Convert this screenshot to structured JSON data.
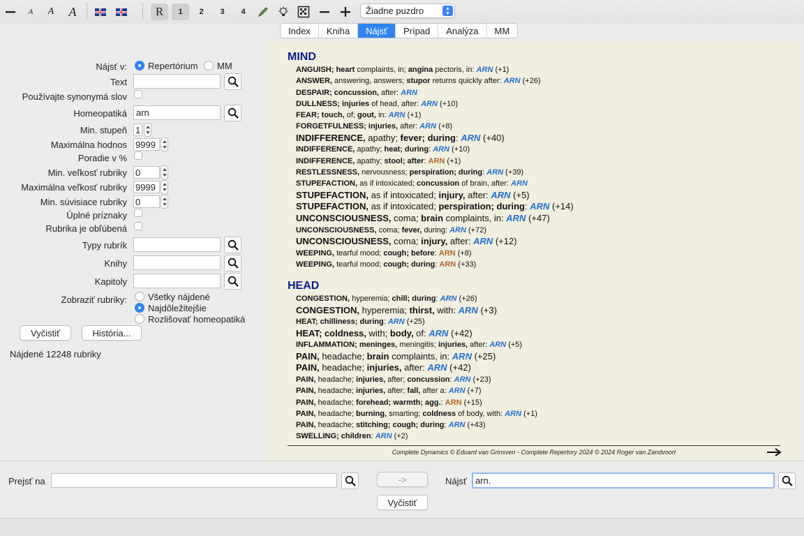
{
  "toolbar": {
    "font_small": "A",
    "font_medium": "A",
    "font_large": "A",
    "mode_r": "R",
    "grade_1": "1",
    "grade_2": "2",
    "grade_3": "3",
    "grade_4": "4",
    "box_select": "Žiadne puzdro"
  },
  "tabs": [
    "Index",
    "Kniha",
    "Nájsť",
    "Prípad",
    "Analýza",
    "MM"
  ],
  "search_form": {
    "find_in_label": "Nájsť v:",
    "opt_repertory": "Repertórium",
    "opt_mm": "MM",
    "text_label": "Text",
    "text_value": "",
    "synonyms_label": "Používajte synonymá slov",
    "remedy_label": "Homeopatiká",
    "remedy_value": "arn",
    "min_degree_label": "Min. stupeň",
    "min_degree_value": "1",
    "max_value_label": "Maximálna hodnos",
    "max_value_value": "9999",
    "order_pct_label": "Poradie v %",
    "min_rubric_size_label": "Min. veľkosť rubriky",
    "min_rubric_size_value": "0",
    "max_rubric_size_label": "Maximálna veľkosť rubriky",
    "max_rubric_size_value": "9999",
    "min_related_label": "Min. súvisiace rubriky",
    "min_related_value": "0",
    "full_symptoms_label": "Úplné príznaky",
    "favourite_label": "Rubrika je obľúbená",
    "rubric_types_label": "Typy rubrík",
    "books_label": "Knihy",
    "chapters_label": "Kapitoly",
    "show_rubrics_label": "Zobraziť rubriky:",
    "show_all": "Všetky nájdené",
    "show_important": "Najdôležitejšie",
    "show_distinguish": "Rozlišovať homeopatiká",
    "clear_button": "Vyčistiť",
    "history_button": "História...",
    "found_text": "Nájdené 12248 rubriky"
  },
  "results": [
    {
      "chapter": "MIND",
      "rubrics": [
        {
          "big": false,
          "parts": [
            [
              "b",
              "ANGUISH; heart"
            ],
            [
              "n",
              " complaints, in; "
            ],
            [
              "b",
              "angina"
            ],
            [
              "n",
              " pectoris, in: "
            ]
          ],
          "remedy": "ARN",
          "brown": false,
          "extra": " (+1)"
        },
        {
          "big": false,
          "parts": [
            [
              "b",
              "ANSWER,"
            ],
            [
              "n",
              " answering, answers; "
            ],
            [
              "b",
              "stupor"
            ],
            [
              "n",
              " returns quickly after: "
            ]
          ],
          "remedy": "ARN",
          "brown": false,
          "extra": " (+26)"
        },
        {
          "big": false,
          "parts": [
            [
              "b",
              "DESPAIR; concussion,"
            ],
            [
              "n",
              " after: "
            ]
          ],
          "remedy": "ARN",
          "brown": false,
          "extra": ""
        },
        {
          "big": false,
          "parts": [
            [
              "b",
              "DULLNESS; injuries"
            ],
            [
              "n",
              " of head, after: "
            ]
          ],
          "remedy": "ARN",
          "brown": false,
          "extra": " (+10)"
        },
        {
          "big": false,
          "parts": [
            [
              "b",
              "FEAR; touch,"
            ],
            [
              "n",
              " of; "
            ],
            [
              "b",
              "gout,"
            ],
            [
              "n",
              " in: "
            ]
          ],
          "remedy": "ARN",
          "brown": false,
          "extra": " (+1)"
        },
        {
          "big": false,
          "parts": [
            [
              "b",
              "FORGETFULNESS; injuries,"
            ],
            [
              "n",
              " after: "
            ]
          ],
          "remedy": "ARN",
          "brown": false,
          "extra": " (+8)"
        },
        {
          "big": true,
          "parts": [
            [
              "b",
              "INDIFFERENCE,"
            ],
            [
              "n",
              " apathy; "
            ],
            [
              "b",
              "fever; during"
            ],
            [
              "n",
              ": "
            ]
          ],
          "remedy": "ARN",
          "brown": false,
          "extra": " (+40)"
        },
        {
          "big": false,
          "parts": [
            [
              "b",
              "INDIFFERENCE,"
            ],
            [
              "n",
              " apathy; "
            ],
            [
              "b",
              "heat; during"
            ],
            [
              "n",
              ": "
            ]
          ],
          "remedy": "ARN",
          "brown": false,
          "extra": " (+10)"
        },
        {
          "big": false,
          "parts": [
            [
              "b",
              "INDIFFERENCE,"
            ],
            [
              "n",
              " apathy; "
            ],
            [
              "b",
              "stool; after"
            ],
            [
              "n",
              ": "
            ]
          ],
          "remedy": "ARN",
          "brown": true,
          "extra": " (+1)"
        },
        {
          "big": false,
          "parts": [
            [
              "b",
              "RESTLESSNESS,"
            ],
            [
              "n",
              " nervousness; "
            ],
            [
              "b",
              "perspiration; during"
            ],
            [
              "n",
              ": "
            ]
          ],
          "remedy": "ARN",
          "brown": false,
          "extra": " (+39)"
        },
        {
          "big": false,
          "parts": [
            [
              "b",
              "STUPEFACTION,"
            ],
            [
              "n",
              " as if intoxicated; "
            ],
            [
              "b",
              "concussion"
            ],
            [
              "n",
              " of brain, after: "
            ]
          ],
          "remedy": "ARN",
          "brown": false,
          "extra": ""
        },
        {
          "big": true,
          "parts": [
            [
              "b",
              "STUPEFACTION,"
            ],
            [
              "n",
              " as if intoxicated; "
            ],
            [
              "b",
              "injury,"
            ],
            [
              "n",
              " after: "
            ]
          ],
          "remedy": "ARN",
          "brown": false,
          "extra": " (+5)"
        },
        {
          "big": true,
          "parts": [
            [
              "b",
              "STUPEFACTION,"
            ],
            [
              "n",
              " as if intoxicated; "
            ],
            [
              "b",
              "perspiration; during"
            ],
            [
              "n",
              ": "
            ]
          ],
          "remedy": "ARN",
          "brown": false,
          "extra": " (+14)"
        },
        {
          "big": true,
          "parts": [
            [
              "b",
              "UNCONSCIOUSNESS,"
            ],
            [
              "n",
              " coma; "
            ],
            [
              "b",
              "brain"
            ],
            [
              "n",
              " complaints, in: "
            ]
          ],
          "remedy": "ARN",
          "brown": false,
          "extra": " (+47)"
        },
        {
          "big": false,
          "parts": [
            [
              "b",
              "UNCONSCIOUSNESS,"
            ],
            [
              "n",
              " coma; "
            ],
            [
              "b",
              "fever,"
            ],
            [
              "n",
              " during: "
            ]
          ],
          "remedy": "ARN",
          "brown": false,
          "extra": " (+72)"
        },
        {
          "big": true,
          "parts": [
            [
              "b",
              "UNCONSCIOUSNESS,"
            ],
            [
              "n",
              " coma; "
            ],
            [
              "b",
              "injury,"
            ],
            [
              "n",
              " after: "
            ]
          ],
          "remedy": "ARN",
          "brown": false,
          "extra": " (+12)"
        },
        {
          "big": false,
          "parts": [
            [
              "b",
              "WEEPING,"
            ],
            [
              "n",
              " tearful mood; "
            ],
            [
              "b",
              "cough; before"
            ],
            [
              "n",
              ": "
            ]
          ],
          "remedy": "ARN",
          "brown": true,
          "extra": " (+8)"
        },
        {
          "big": false,
          "parts": [
            [
              "b",
              "WEEPING,"
            ],
            [
              "n",
              " tearful mood; "
            ],
            [
              "b",
              "cough; during"
            ],
            [
              "n",
              ": "
            ]
          ],
          "remedy": "ARN",
          "brown": true,
          "extra": " (+33)"
        }
      ]
    },
    {
      "chapter": "HEAD",
      "rubrics": [
        {
          "big": false,
          "parts": [
            [
              "b",
              "CONGESTION,"
            ],
            [
              "n",
              " hyperemia; "
            ],
            [
              "b",
              "chill; during"
            ],
            [
              "n",
              ": "
            ]
          ],
          "remedy": "ARN",
          "brown": false,
          "extra": " (+26)"
        },
        {
          "big": true,
          "parts": [
            [
              "b",
              "CONGESTION,"
            ],
            [
              "n",
              " hyperemia; "
            ],
            [
              "b",
              "thirst,"
            ],
            [
              "n",
              " with: "
            ]
          ],
          "remedy": "ARN",
          "brown": false,
          "extra": " (+3)"
        },
        {
          "big": false,
          "parts": [
            [
              "b",
              "HEAT; chilliness; during"
            ],
            [
              "n",
              ": "
            ]
          ],
          "remedy": "ARN",
          "brown": false,
          "extra": " (+25)"
        },
        {
          "big": true,
          "parts": [
            [
              "b",
              "HEAT; coldness,"
            ],
            [
              "n",
              " with; "
            ],
            [
              "b",
              "body,"
            ],
            [
              "n",
              " of: "
            ]
          ],
          "remedy": "ARN",
          "brown": false,
          "extra": " (+42)"
        },
        {
          "big": false,
          "parts": [
            [
              "b",
              "INFLAMMATION; meninges,"
            ],
            [
              "n",
              " meningitis; "
            ],
            [
              "b",
              "injuries,"
            ],
            [
              "n",
              " after: "
            ]
          ],
          "remedy": "ARN",
          "brown": false,
          "extra": " (+5)"
        },
        {
          "big": true,
          "parts": [
            [
              "b",
              "PAIN,"
            ],
            [
              "n",
              " headache; "
            ],
            [
              "b",
              "brain"
            ],
            [
              "n",
              " complaints, in: "
            ]
          ],
          "remedy": "ARN",
          "brown": false,
          "extra": " (+25)"
        },
        {
          "big": true,
          "parts": [
            [
              "b",
              "PAIN,"
            ],
            [
              "n",
              " headache; "
            ],
            [
              "b",
              "injuries,"
            ],
            [
              "n",
              " after: "
            ]
          ],
          "remedy": "ARN",
          "brown": false,
          "extra": " (+42)"
        },
        {
          "big": false,
          "parts": [
            [
              "b",
              "PAIN,"
            ],
            [
              "n",
              " headache; "
            ],
            [
              "b",
              "injuries,"
            ],
            [
              "n",
              " after; "
            ],
            [
              "b",
              "concussion"
            ],
            [
              "n",
              ": "
            ]
          ],
          "remedy": "ARN",
          "brown": false,
          "extra": " (+23)"
        },
        {
          "big": false,
          "parts": [
            [
              "b",
              "PAIN,"
            ],
            [
              "n",
              " headache; "
            ],
            [
              "b",
              "injuries,"
            ],
            [
              "n",
              " after; "
            ],
            [
              "b",
              "fall,"
            ],
            [
              "n",
              " after a: "
            ]
          ],
          "remedy": "ARN",
          "brown": false,
          "extra": " (+7)"
        },
        {
          "big": false,
          "parts": [
            [
              "b",
              "PAIN,"
            ],
            [
              "n",
              " headache; "
            ],
            [
              "b",
              "forehead; warmth; agg."
            ],
            [
              "n",
              ": "
            ]
          ],
          "remedy": "ARN",
          "brown": true,
          "extra": " (+15)"
        },
        {
          "big": false,
          "parts": [
            [
              "b",
              "PAIN,"
            ],
            [
              "n",
              " headache; "
            ],
            [
              "b",
              "burning,"
            ],
            [
              "n",
              " smarting; "
            ],
            [
              "b",
              "coldness"
            ],
            [
              "n",
              " of body, with: "
            ]
          ],
          "remedy": "ARN",
          "brown": false,
          "extra": " (+1)"
        },
        {
          "big": false,
          "parts": [
            [
              "b",
              "PAIN,"
            ],
            [
              "n",
              " headache; "
            ],
            [
              "b",
              "stitching; cough; during"
            ],
            [
              "n",
              ": "
            ]
          ],
          "remedy": "ARN",
          "brown": false,
          "extra": " (+43)"
        },
        {
          "big": false,
          "parts": [
            [
              "b",
              "SWELLING; children"
            ],
            [
              "n",
              ": "
            ]
          ],
          "remedy": "ARN",
          "brown": false,
          "extra": " (+2)"
        }
      ]
    }
  ],
  "footer_text": "Complete Dynamics © Eduard van Grinsven   -   Complete Repertory 2024 © 2024 Roger van Zandvoort",
  "bottom": {
    "goto_label": "Prejsť na",
    "goto_value": "",
    "arrow_button": "->",
    "find_label": "Nájsť",
    "find_value": "arn.",
    "clear_button": "Vyčistiť"
  },
  "colors": {
    "accent": "#2f86f0",
    "chapter": "#0b1d8e",
    "remedy_blue": "#1f6fd1",
    "remedy_brown": "#b0682a",
    "result_bg": "#f1efdf"
  }
}
